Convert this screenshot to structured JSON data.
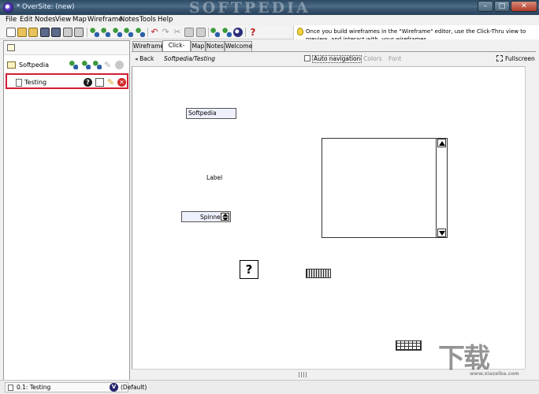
{
  "window": {
    "title": "* OverSite: (new)",
    "watermark": "SOFTPEDIA",
    "min_glyph": "–",
    "max_glyph": "□",
    "close_glyph": "✕"
  },
  "menu": [
    "File",
    "Edit",
    "Nodes",
    "View",
    "Map",
    "Wireframe",
    "Notes",
    "Tools",
    "Help"
  ],
  "tip": {
    "text": "Once you build wireframes in the \"Wireframe\" editor, use the Click-Thru view to preview, and interact with, your wireframes."
  },
  "toolbar": {
    "undo_glyph": "↶",
    "redo_glyph": "↷",
    "cut_glyph": "✂",
    "help_glyph": "?"
  },
  "tree": {
    "items": [
      {
        "label": "Softpedia"
      },
      {
        "label": "Testing"
      }
    ],
    "icons": {
      "help": "?",
      "delete": "✕",
      "edit": "✎"
    }
  },
  "tabs": [
    "Wireframe",
    "Click-thru",
    "Map",
    "Notes",
    "Welcome"
  ],
  "active_tab": "Click-thru",
  "nav": {
    "back_arrow": "◂",
    "back_label": "Back",
    "breadcrumb": "Softpedia/Testing",
    "auto_navigation": "Auto navigation",
    "colors_label": "▾ Colors",
    "font_label": "Font",
    "fullscreen": "Fullscreen"
  },
  "canvas": {
    "input_text": "Softpedia",
    "label_text": "Label",
    "spinner_text": "Spinner",
    "image_glyph": "?"
  },
  "corner_logo": {
    "mark": "下载",
    "site": "www.xiazaiba.com"
  },
  "status": {
    "path": "0.1: Testing",
    "badge": "V",
    "scheme": "(Default)"
  },
  "colors": {
    "selection_border": "#d21e36",
    "titlebar": "#3d5a75",
    "widget_fill": "#eef0fb"
  }
}
